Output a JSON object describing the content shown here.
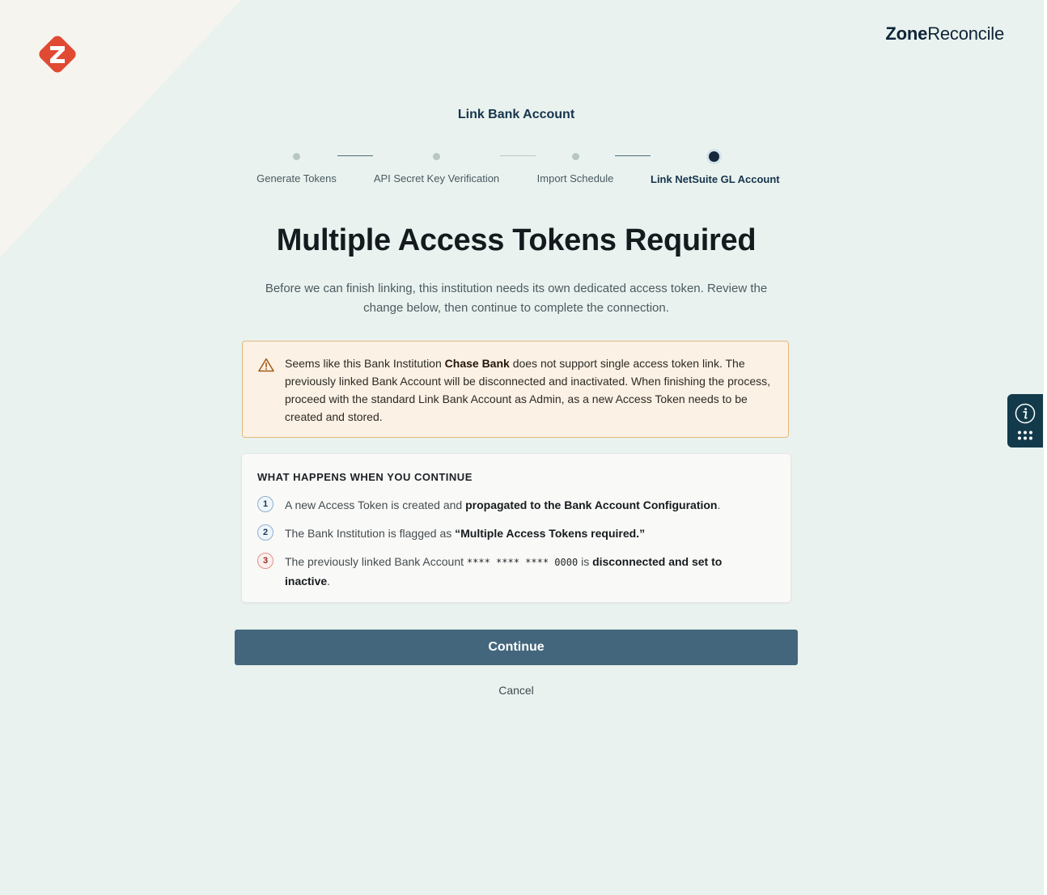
{
  "brand": {
    "logo_letter": "z",
    "name_bold": "Zone",
    "name_light": "Reconcile"
  },
  "colors": {
    "background": "#e9f2ee",
    "corner": "#f6f4ee",
    "logo": "#e04a32",
    "primary_button": "#43667d",
    "warning_bg": "#fbf1e4",
    "warning_border": "#e4b97c"
  },
  "page": {
    "heading": "Link Bank Account",
    "title": "Multiple Access Tokens Required",
    "subtitle": "Before we can finish linking, this institution needs its own dedicated access token. Review the change below, then continue to complete the connection."
  },
  "stepper": {
    "steps": [
      {
        "label": "Generate Tokens",
        "state": "inactive"
      },
      {
        "label": "API Secret Key Verification",
        "state": "inactive"
      },
      {
        "label": "Import Schedule",
        "state": "inactive"
      },
      {
        "label": "Link NetSuite GL Account",
        "state": "active"
      }
    ]
  },
  "warning": {
    "icon": "warning-triangle-icon",
    "before": "Seems like this Bank Institution ",
    "bank_name": "Chase Bank",
    "after": " does not support single access token link. The previously linked Bank Account will be disconnected and inactivated. When finishing the process, proceed with the standard Link Bank Account as Admin, as a new Access Token needs to be created and stored."
  },
  "continue_section": {
    "heading": "WHAT HAPPENS WHEN YOU CONTINUE",
    "items": [
      {
        "number": "1",
        "text_before": "A new Access Token is created and ",
        "bold": "propagated to the Bank Account Configuration",
        "text_after": "."
      },
      {
        "number": "2",
        "text_before": "The Bank Institution is flagged as ",
        "bold": "“Multiple Access Tokens required.”",
        "text_after": ""
      },
      {
        "number": "3",
        "text_before": "The previously linked Bank Account ",
        "account_mask": "**** **** **** 0000",
        "text_middle": " is ",
        "bold": "disconnected and set to inactive",
        "text_after": "."
      }
    ]
  },
  "actions": {
    "continue_label": "Continue",
    "cancel_label": "Cancel"
  },
  "side_widget": {
    "icons": [
      "info-icon",
      "apps-grid-icon"
    ]
  }
}
